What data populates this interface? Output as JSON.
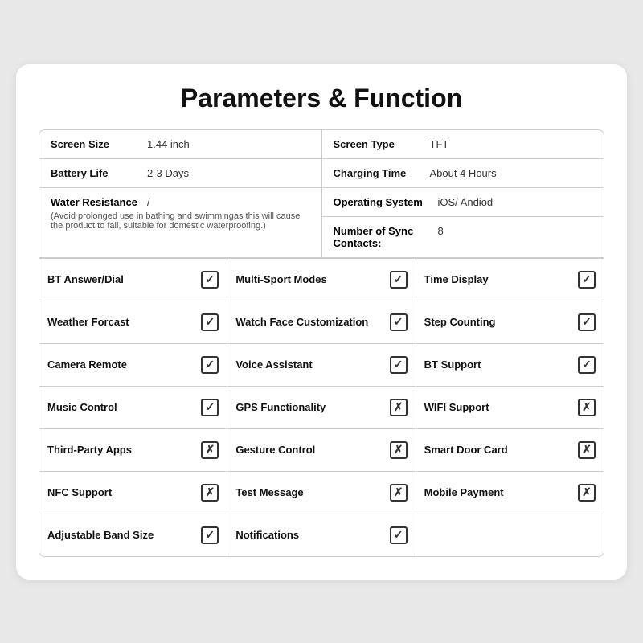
{
  "title": "Parameters & Function",
  "specs": [
    {
      "row": [
        {
          "label": "Screen Size",
          "value": "1.44 inch"
        },
        {
          "label": "Screen Type",
          "value": "TFT"
        }
      ]
    },
    {
      "row": [
        {
          "label": "Battery Life",
          "value": "2-3 Days"
        },
        {
          "label": "Charging Time",
          "value": "About 4 Hours"
        }
      ]
    }
  ],
  "water": {
    "label": "Water Resistance",
    "value": "/",
    "note": "(Avoid prolonged use in bathing and swimmingas this will cause the product to fail, suitable for domestic waterproofing.)",
    "right": [
      {
        "label": "Operating System",
        "value": "iOS/ Andiod"
      },
      {
        "label": "Number of Sync Contacts:",
        "value": "8"
      }
    ]
  },
  "features": [
    [
      {
        "label": "BT Answer/Dial",
        "check": true
      },
      {
        "label": "Multi-Sport Modes",
        "check": true
      },
      {
        "label": "Time Display",
        "check": true
      }
    ],
    [
      {
        "label": "Weather Forcast",
        "check": true
      },
      {
        "label": "Watch Face Customization",
        "check": true
      },
      {
        "label": "Step Counting",
        "check": true
      }
    ],
    [
      {
        "label": "Camera Remote",
        "check": true
      },
      {
        "label": "Voice Assistant",
        "check": true
      },
      {
        "label": "BT Support",
        "check": true
      }
    ],
    [
      {
        "label": "Music Control",
        "check": true
      },
      {
        "label": "GPS Functionality",
        "check": false
      },
      {
        "label": "WIFI Support",
        "check": false
      }
    ],
    [
      {
        "label": "Third-Party Apps",
        "check": false
      },
      {
        "label": "Gesture Control",
        "check": false
      },
      {
        "label": "Smart Door Card",
        "check": false
      }
    ],
    [
      {
        "label": "NFC Support",
        "check": false
      },
      {
        "label": "Test Message",
        "check": false
      },
      {
        "label": "Mobile Payment",
        "check": false
      }
    ],
    [
      {
        "label": "Adjustable Band Size",
        "check": true
      },
      {
        "label": "Notifications",
        "check": true
      },
      {
        "label": "",
        "check": null
      }
    ]
  ]
}
